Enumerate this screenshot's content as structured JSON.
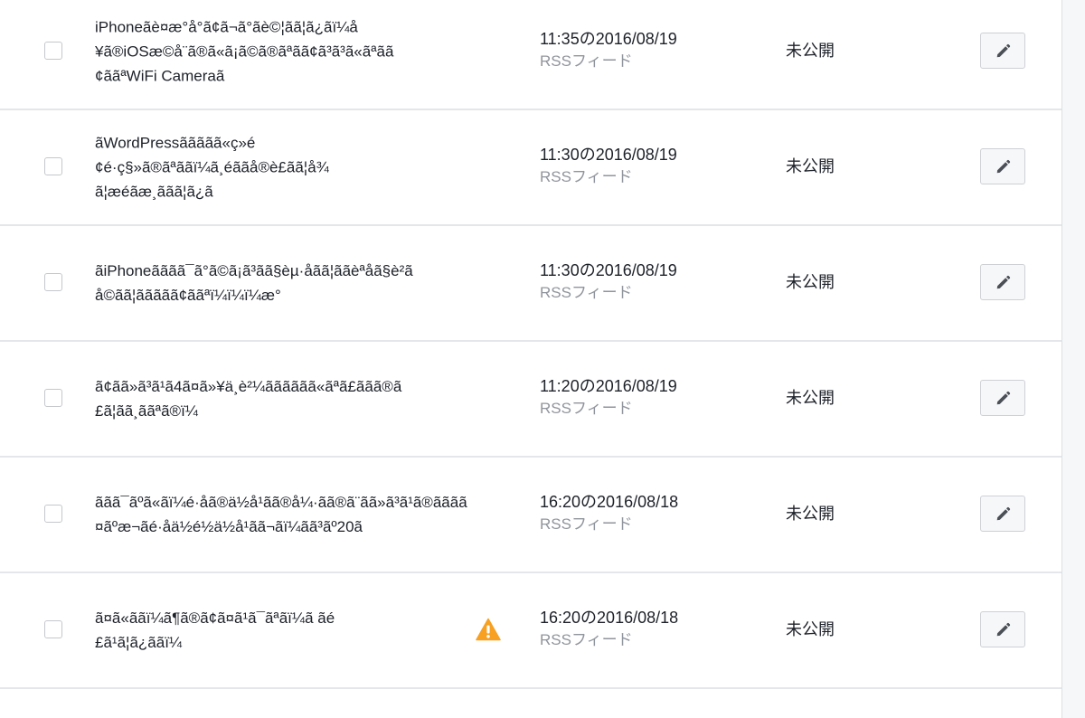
{
  "colors": {
    "background": "#f6f7f9",
    "text": "#1d2129",
    "muted": "#90949c",
    "warning": "#f7a022",
    "divider": "#e5e6e9"
  },
  "posts": [
    {
      "title": "iPhoneãè¤æ°å°ã¢ã¬ã°ãè©¦ãã¦ã¿ãï¼å\n¥ã®iOSæ©å¨ã®ã«ã¡ã©ã®ãªãã¢ã³ã³ã«ãªãã\n¢ããªWiFi Cameraã",
      "time": "11:35の2016/08/19",
      "source": "RSSフィード",
      "status": "未公開",
      "warning": false,
      "icons": {
        "edit": "pencil-icon"
      }
    },
    {
      "title": "ãWordPressããããã«ç»é\n¢é·ç§»ã®ãªããï¼ã¸éããå®è£ãã¦å¾\nã¦æéãæ¸ããã¦ã¿ã",
      "time": "11:30の2016/08/19",
      "source": "RSSフィード",
      "status": "未公開",
      "warning": false,
      "icons": {
        "edit": "pencil-icon"
      }
    },
    {
      "title": "ãiPhoneãããã¯ã°ã©ã¡ã³ãã§èµ·åãã¦ããèªåã§è²ã\nå©ãã¦ããããã¢ããªï¼ï¼ï¼æ°",
      "time": "11:30の2016/08/19",
      "source": "RSSフィード",
      "status": "未公開",
      "warning": false,
      "icons": {
        "edit": "pencil-icon"
      }
    },
    {
      "title": "ã¢ãã»ã³ã¹ã4ã¤ã»¥ä¸è²¼ãããããã«ãªã£ããã®ã\n£ã¦ãã¸ããªã®ï¼",
      "time": "11:20の2016/08/19",
      "source": "RSSフィード",
      "status": "未公開",
      "warning": false,
      "icons": {
        "edit": "pencil-icon"
      }
    },
    {
      "title": "ããã¯ãºã«ãï¼é·åã®ä½å¹ãã®å¼·ãã®ã¨ãã»ã³ã¹ã®ãããã\n¤ãºæ¬ãé·åä½é½ä½å¹ãã¬ãï¼ãã³ãº20ã",
      "time": "16:20の2016/08/18",
      "source": "RSSフィード",
      "status": "未公開",
      "warning": false,
      "icons": {
        "edit": "pencil-icon"
      }
    },
    {
      "title": "ã¤ã«ããï¼ã¶ã®ã¢ã¤ã¹ã¯ãªãï¼ã ãé\n£ã¹ã¦ã¿ããï¼",
      "time": "16:20の2016/08/18",
      "source": "RSSフィード",
      "status": "未公開",
      "warning": true,
      "icons": {
        "edit": "pencil-icon",
        "warning": "warning-icon"
      }
    }
  ]
}
